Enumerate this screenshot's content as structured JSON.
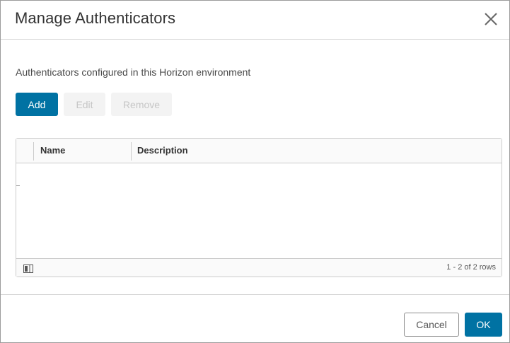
{
  "dialog": {
    "title": "Manage Authenticators",
    "close_icon": "close-icon"
  },
  "content": {
    "subtitle": "Authenticators configured in this Horizon environment"
  },
  "toolbar": {
    "add_label": "Add",
    "edit_label": "Edit",
    "remove_label": "Remove"
  },
  "grid": {
    "columns": [
      {
        "label": "Name"
      },
      {
        "label": "Description"
      }
    ],
    "rows": [],
    "footer": {
      "column_toggle_icon": "column-toggle-icon",
      "row_count": "1 - 2 of 2 rows"
    }
  },
  "footer": {
    "cancel_label": "Cancel",
    "ok_label": "OK"
  },
  "colors": {
    "primary": "#0072a3",
    "disabled_bg": "#f3f3f3",
    "disabled_text": "#c6c6c6",
    "border": "#cccccc"
  }
}
